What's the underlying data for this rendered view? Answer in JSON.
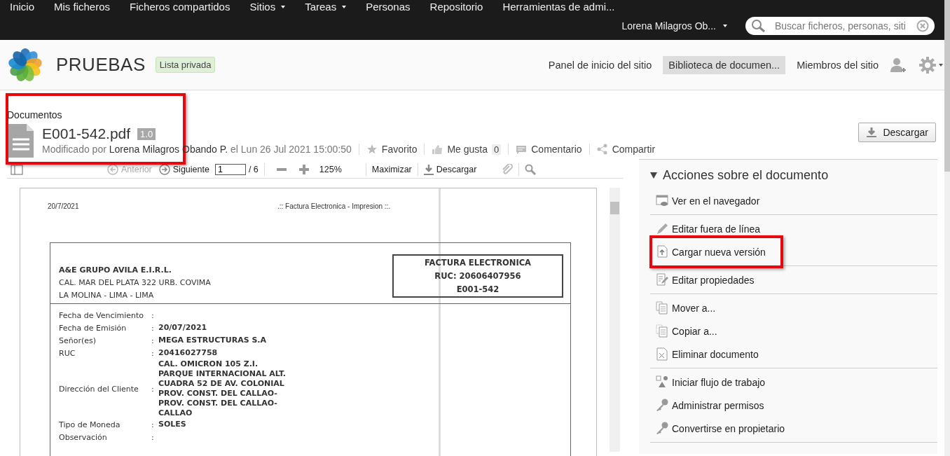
{
  "top_nav": {
    "items": [
      {
        "label": "Inicio",
        "has_menu": false
      },
      {
        "label": "Mis ficheros",
        "has_menu": false
      },
      {
        "label": "Ficheros compartidos",
        "has_menu": false
      },
      {
        "label": "Sitios",
        "has_menu": true
      },
      {
        "label": "Tareas",
        "has_menu": true
      },
      {
        "label": "Personas",
        "has_menu": false
      },
      {
        "label": "Repositorio",
        "has_menu": false
      },
      {
        "label": "Herramientas de admi...",
        "has_menu": false
      }
    ],
    "user_menu": "Lorena Milagros Ob...",
    "search": {
      "placeholder": "Buscar ficheros, personas, siti"
    }
  },
  "site_header": {
    "title": "PRUEBAS",
    "visibility_badge": "Lista privada",
    "nav": [
      {
        "label": "Panel de inicio del sitio",
        "selected": false
      },
      {
        "label": "Biblioteca de documen...",
        "selected": true
      },
      {
        "label": "Miembros del sitio",
        "selected": false
      }
    ]
  },
  "doc_header": {
    "breadcrumb": "Documentos",
    "file_name": "E001-542.pdf",
    "version": "1.0",
    "modified_prefix": "Modificado por",
    "modified_by": "Lorena Milagros Obando P.",
    "modified_suffix": "el Lun 26 Jul 2021 15:00:50",
    "highlighted": true,
    "actions": [
      {
        "label": "Favorito"
      },
      {
        "label": "Me gusta",
        "count": "0"
      },
      {
        "label": "Comentario"
      },
      {
        "label": "Compartir"
      }
    ],
    "download_button": "Descargar"
  },
  "viewer_toolbar": {
    "previous": {
      "label": "Anterior",
      "disabled": true
    },
    "next": {
      "label": "Siguiente",
      "disabled": false
    },
    "page": "1",
    "page_total": "/ 6",
    "zoom": "125%",
    "maximize": "Maximizar",
    "download": "Descargar"
  },
  "document": {
    "date": "20/7/2021",
    "heading": ".:: Factura Electronica - Impresion ::.",
    "issuer_name": "A&E GRUPO AVILA E.I.R.L.",
    "issuer_address": [
      "CAL. MAR DEL PLATA 322 URB. COVIMA",
      "LA MOLINA - LIMA - LIMA"
    ],
    "invoice_box": [
      "FACTURA ELECTRONICA",
      "RUC: 20606407956",
      "E001-542"
    ],
    "fields": [
      {
        "label": "Fecha de Vencimiento",
        "separator": ":"
      },
      {
        "label": "Fecha de Emisión",
        "separator": ":",
        "value": [
          "20/07/2021"
        ]
      },
      {
        "label": "Señor(es)",
        "separator": ":",
        "value": [
          "MEGA ESTRUCTURAS S.A"
        ]
      },
      {
        "label": "RUC",
        "separator": ":",
        "value": [
          "20416027758"
        ]
      },
      {
        "label": "Dirección del Cliente",
        "separator": ":",
        "value": [
          "CAL. OMICRON 105 Z.I.",
          "PARQUE INTERNACIONAL ALT.",
          "CUADRA 52 DE AV. COLONIAL",
          "PROV. CONST. DEL CALLAO-",
          "PROV. CONST. DEL CALLAO-",
          "CALLAO"
        ]
      },
      {
        "label": "Tipo de Moneda",
        "separator": ":",
        "value": [
          "SOLES"
        ]
      },
      {
        "label": "Observación",
        "separator": ":"
      }
    ]
  },
  "actions_panel": {
    "title": "Acciones sobre el documento",
    "expanded": true,
    "groups": [
      [
        {
          "label": "Ver en el navegador",
          "highlighted": false
        }
      ],
      [
        {
          "label": "Editar fuera de línea",
          "highlighted": false
        },
        {
          "label": "Cargar nueva versión",
          "highlighted": true
        }
      ],
      [
        {
          "label": "Editar propiedades",
          "highlighted": false
        }
      ],
      [
        {
          "label": "Mover a...",
          "highlighted": false
        },
        {
          "label": "Copiar a...",
          "highlighted": false
        },
        {
          "label": "Eliminar documento",
          "highlighted": false
        }
      ],
      [
        {
          "label": "Iniciar flujo de trabajo",
          "highlighted": false
        },
        {
          "label": "Administrar permisos",
          "highlighted": false
        },
        {
          "label": "Convertirse en propietario",
          "highlighted": false
        }
      ]
    ]
  }
}
